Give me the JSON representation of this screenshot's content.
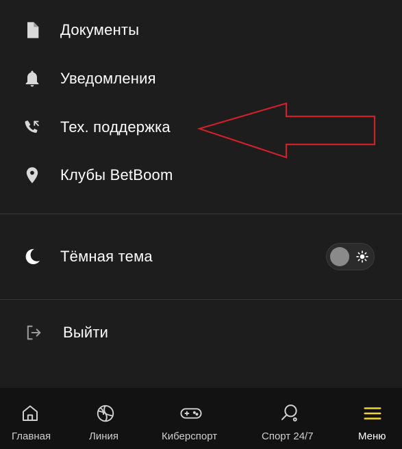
{
  "menu": {
    "items": [
      {
        "label": "Документы",
        "icon": "document-icon"
      },
      {
        "label": "Уведомления",
        "icon": "bell-icon"
      },
      {
        "label": "Тех. поддержка",
        "icon": "phone-support-icon"
      },
      {
        "label": "Клубы BetBoom",
        "icon": "location-pin-icon"
      }
    ],
    "dark_theme": {
      "label": "Тёмная тема",
      "icon": "moon-icon",
      "enabled": false
    },
    "logout": {
      "label": "Выйти",
      "icon": "logout-icon"
    }
  },
  "bottom_nav": {
    "items": [
      {
        "label": "Главная",
        "icon": "home-icon"
      },
      {
        "label": "Линия",
        "icon": "ball-icon"
      },
      {
        "label": "Киберспорт",
        "icon": "gamepad-icon"
      },
      {
        "label": "Спорт 24/7",
        "icon": "ping-pong-icon"
      },
      {
        "label": "Меню",
        "icon": "hamburger-menu-icon",
        "active": true
      }
    ]
  },
  "colors": {
    "background": "#1d1d1d",
    "bottom_nav_background": "#121212",
    "accent_yellow": "#f2d530",
    "annotation_arrow": "#d1202a"
  }
}
